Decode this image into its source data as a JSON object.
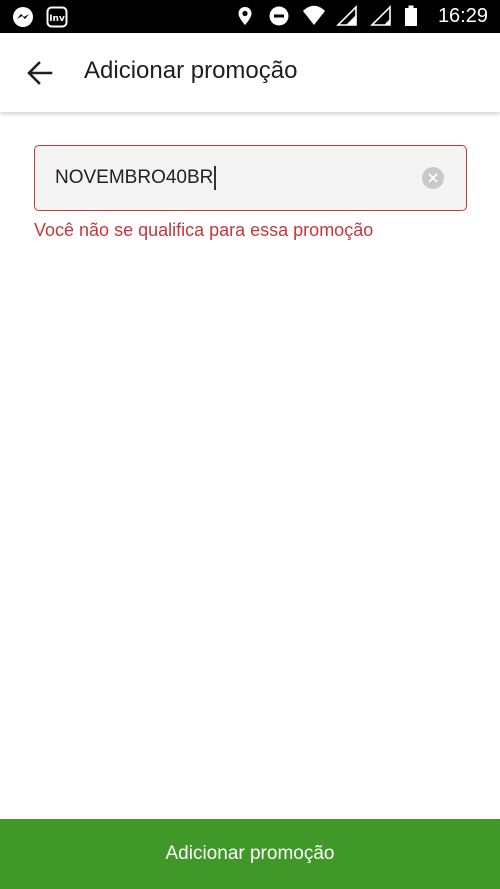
{
  "status_bar": {
    "time": "16:29",
    "left_icons": [
      "messenger-icon",
      "inv-app-icon"
    ],
    "right_icons": [
      "location-icon",
      "do-not-disturb-icon",
      "wifi-icon",
      "signal-icon",
      "signal-icon",
      "battery-icon"
    ],
    "inv_label": "Inv"
  },
  "app_bar": {
    "title": "Adicionar promoção",
    "back_icon": "arrow-left-icon"
  },
  "promo": {
    "value": "NOVEMBRO40BR",
    "clear_icon": "clear-icon",
    "error": "Você não se qualifica para essa promoção"
  },
  "footer": {
    "button_label": "Adicionar promoção"
  },
  "colors": {
    "error": "#c5373b",
    "primary": "#3f9827",
    "status_bar": "#000000"
  }
}
